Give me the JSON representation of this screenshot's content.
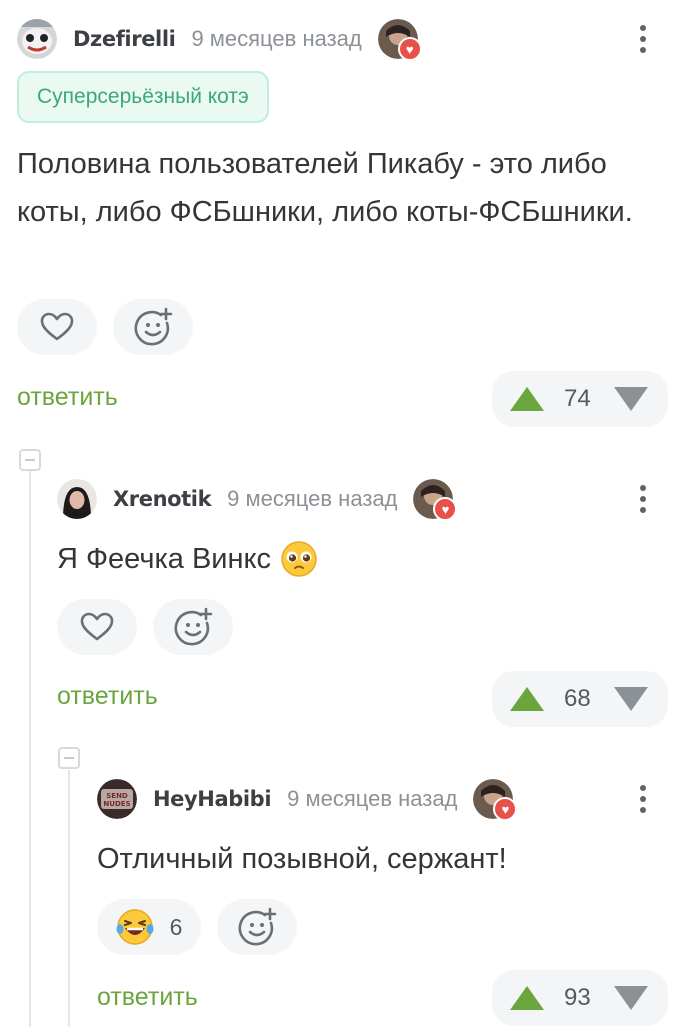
{
  "comments": [
    {
      "author": "Dzefirelli",
      "time": "9 месяцев назад",
      "badge": "Суперсерьёзный котэ",
      "text": "Половина пользователей Пикабу - это либо коты, либо ФСБшники, либо коты-ФСБшники.",
      "reply_label": "ответить",
      "rating": "74"
    },
    {
      "author": "Xrenotik",
      "time": "9 месяцев назад",
      "text": "Я Феечка Винкс",
      "reply_label": "ответить",
      "rating": "68"
    },
    {
      "author": "HeyHabibi",
      "time": "9 месяцев назад",
      "text": "Отличный позывной, сержант!",
      "reaction_count": "6",
      "reply_label": "ответить",
      "rating": "93"
    }
  ],
  "colors": {
    "accent_green": "#6aa53e",
    "badge_text": "#3aa87c",
    "badge_bg": "#eafaf3",
    "heart_badge": "#e8504a"
  },
  "icons": [
    "heart-icon",
    "add-emoji-icon",
    "laughing-emoji-icon",
    "pleading-emoji-icon",
    "more-vertical-icon",
    "upvote-icon",
    "downvote-icon",
    "collapse-icon"
  ]
}
